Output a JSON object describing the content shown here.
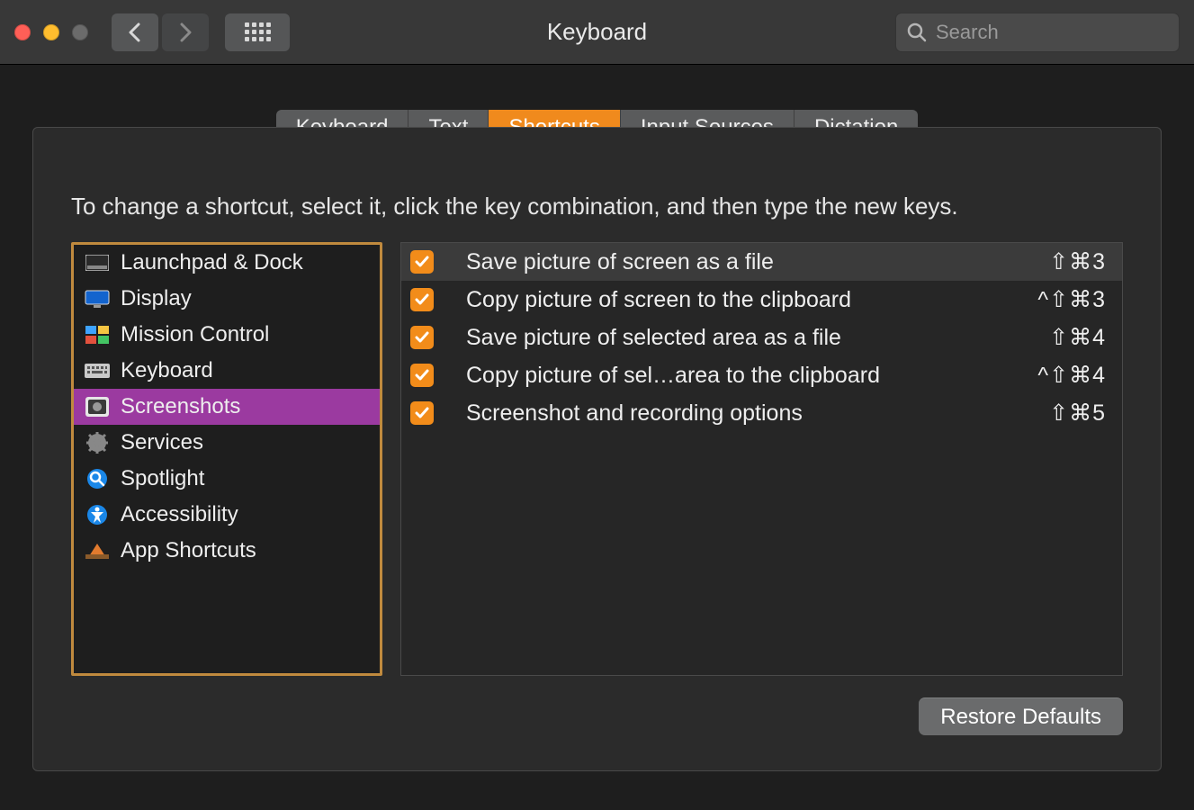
{
  "window": {
    "title": "Keyboard",
    "search_placeholder": "Search"
  },
  "tabs": [
    {
      "label": "Keyboard",
      "active": false
    },
    {
      "label": "Text",
      "active": false
    },
    {
      "label": "Shortcuts",
      "active": true
    },
    {
      "label": "Input Sources",
      "active": false
    },
    {
      "label": "Dictation",
      "active": false
    }
  ],
  "instruction": "To change a shortcut, select it, click the key combination, and then type the new keys.",
  "categories": [
    {
      "label": "Launchpad & Dock",
      "icon": "launchpad",
      "selected": false
    },
    {
      "label": "Display",
      "icon": "display",
      "selected": false
    },
    {
      "label": "Mission Control",
      "icon": "mission",
      "selected": false
    },
    {
      "label": "Keyboard",
      "icon": "keyboard",
      "selected": false
    },
    {
      "label": "Screenshots",
      "icon": "camera",
      "selected": true
    },
    {
      "label": "Services",
      "icon": "gear",
      "selected": false
    },
    {
      "label": "Spotlight",
      "icon": "spotlight",
      "selected": false
    },
    {
      "label": "Accessibility",
      "icon": "accessibility",
      "selected": false
    },
    {
      "label": "App Shortcuts",
      "icon": "app",
      "selected": false
    }
  ],
  "shortcuts": [
    {
      "checked": true,
      "label": "Save picture of screen as a file",
      "keys": "⇧⌘3",
      "highlight": true
    },
    {
      "checked": true,
      "label": "Copy picture of screen to the clipboard",
      "keys": "^⇧⌘3",
      "highlight": false
    },
    {
      "checked": true,
      "label": "Save picture of selected area as a file",
      "keys": "⇧⌘4",
      "highlight": false
    },
    {
      "checked": true,
      "label": "Copy picture of sel…area to the clipboard",
      "keys": "^⇧⌘4",
      "highlight": false
    },
    {
      "checked": true,
      "label": "Screenshot and recording options",
      "keys": "⇧⌘5",
      "highlight": false
    }
  ],
  "restore_label": "Restore Defaults"
}
